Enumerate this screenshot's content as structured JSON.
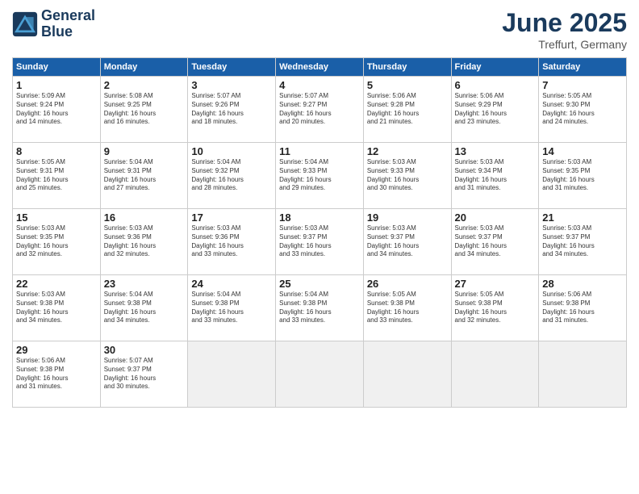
{
  "logo": {
    "line1": "General",
    "line2": "Blue"
  },
  "title": "June 2025",
  "location": "Treffurt, Germany",
  "days_header": [
    "Sunday",
    "Monday",
    "Tuesday",
    "Wednesday",
    "Thursday",
    "Friday",
    "Saturday"
  ],
  "weeks": [
    [
      {
        "day": "1",
        "lines": [
          "Sunrise: 5:09 AM",
          "Sunset: 9:24 PM",
          "Daylight: 16 hours",
          "and 14 minutes."
        ]
      },
      {
        "day": "2",
        "lines": [
          "Sunrise: 5:08 AM",
          "Sunset: 9:25 PM",
          "Daylight: 16 hours",
          "and 16 minutes."
        ]
      },
      {
        "day": "3",
        "lines": [
          "Sunrise: 5:07 AM",
          "Sunset: 9:26 PM",
          "Daylight: 16 hours",
          "and 18 minutes."
        ]
      },
      {
        "day": "4",
        "lines": [
          "Sunrise: 5:07 AM",
          "Sunset: 9:27 PM",
          "Daylight: 16 hours",
          "and 20 minutes."
        ]
      },
      {
        "day": "5",
        "lines": [
          "Sunrise: 5:06 AM",
          "Sunset: 9:28 PM",
          "Daylight: 16 hours",
          "and 21 minutes."
        ]
      },
      {
        "day": "6",
        "lines": [
          "Sunrise: 5:06 AM",
          "Sunset: 9:29 PM",
          "Daylight: 16 hours",
          "and 23 minutes."
        ]
      },
      {
        "day": "7",
        "lines": [
          "Sunrise: 5:05 AM",
          "Sunset: 9:30 PM",
          "Daylight: 16 hours",
          "and 24 minutes."
        ]
      }
    ],
    [
      {
        "day": "8",
        "lines": [
          "Sunrise: 5:05 AM",
          "Sunset: 9:31 PM",
          "Daylight: 16 hours",
          "and 25 minutes."
        ]
      },
      {
        "day": "9",
        "lines": [
          "Sunrise: 5:04 AM",
          "Sunset: 9:31 PM",
          "Daylight: 16 hours",
          "and 27 minutes."
        ]
      },
      {
        "day": "10",
        "lines": [
          "Sunrise: 5:04 AM",
          "Sunset: 9:32 PM",
          "Daylight: 16 hours",
          "and 28 minutes."
        ]
      },
      {
        "day": "11",
        "lines": [
          "Sunrise: 5:04 AM",
          "Sunset: 9:33 PM",
          "Daylight: 16 hours",
          "and 29 minutes."
        ]
      },
      {
        "day": "12",
        "lines": [
          "Sunrise: 5:03 AM",
          "Sunset: 9:33 PM",
          "Daylight: 16 hours",
          "and 30 minutes."
        ]
      },
      {
        "day": "13",
        "lines": [
          "Sunrise: 5:03 AM",
          "Sunset: 9:34 PM",
          "Daylight: 16 hours",
          "and 31 minutes."
        ]
      },
      {
        "day": "14",
        "lines": [
          "Sunrise: 5:03 AM",
          "Sunset: 9:35 PM",
          "Daylight: 16 hours",
          "and 31 minutes."
        ]
      }
    ],
    [
      {
        "day": "15",
        "lines": [
          "Sunrise: 5:03 AM",
          "Sunset: 9:35 PM",
          "Daylight: 16 hours",
          "and 32 minutes."
        ]
      },
      {
        "day": "16",
        "lines": [
          "Sunrise: 5:03 AM",
          "Sunset: 9:36 PM",
          "Daylight: 16 hours",
          "and 32 minutes."
        ]
      },
      {
        "day": "17",
        "lines": [
          "Sunrise: 5:03 AM",
          "Sunset: 9:36 PM",
          "Daylight: 16 hours",
          "and 33 minutes."
        ]
      },
      {
        "day": "18",
        "lines": [
          "Sunrise: 5:03 AM",
          "Sunset: 9:37 PM",
          "Daylight: 16 hours",
          "and 33 minutes."
        ]
      },
      {
        "day": "19",
        "lines": [
          "Sunrise: 5:03 AM",
          "Sunset: 9:37 PM",
          "Daylight: 16 hours",
          "and 34 minutes."
        ]
      },
      {
        "day": "20",
        "lines": [
          "Sunrise: 5:03 AM",
          "Sunset: 9:37 PM",
          "Daylight: 16 hours",
          "and 34 minutes."
        ]
      },
      {
        "day": "21",
        "lines": [
          "Sunrise: 5:03 AM",
          "Sunset: 9:37 PM",
          "Daylight: 16 hours",
          "and 34 minutes."
        ]
      }
    ],
    [
      {
        "day": "22",
        "lines": [
          "Sunrise: 5:03 AM",
          "Sunset: 9:38 PM",
          "Daylight: 16 hours",
          "and 34 minutes."
        ]
      },
      {
        "day": "23",
        "lines": [
          "Sunrise: 5:04 AM",
          "Sunset: 9:38 PM",
          "Daylight: 16 hours",
          "and 34 minutes."
        ]
      },
      {
        "day": "24",
        "lines": [
          "Sunrise: 5:04 AM",
          "Sunset: 9:38 PM",
          "Daylight: 16 hours",
          "and 33 minutes."
        ]
      },
      {
        "day": "25",
        "lines": [
          "Sunrise: 5:04 AM",
          "Sunset: 9:38 PM",
          "Daylight: 16 hours",
          "and 33 minutes."
        ]
      },
      {
        "day": "26",
        "lines": [
          "Sunrise: 5:05 AM",
          "Sunset: 9:38 PM",
          "Daylight: 16 hours",
          "and 33 minutes."
        ]
      },
      {
        "day": "27",
        "lines": [
          "Sunrise: 5:05 AM",
          "Sunset: 9:38 PM",
          "Daylight: 16 hours",
          "and 32 minutes."
        ]
      },
      {
        "day": "28",
        "lines": [
          "Sunrise: 5:06 AM",
          "Sunset: 9:38 PM",
          "Daylight: 16 hours",
          "and 31 minutes."
        ]
      }
    ],
    [
      {
        "day": "29",
        "lines": [
          "Sunrise: 5:06 AM",
          "Sunset: 9:38 PM",
          "Daylight: 16 hours",
          "and 31 minutes."
        ]
      },
      {
        "day": "30",
        "lines": [
          "Sunrise: 5:07 AM",
          "Sunset: 9:37 PM",
          "Daylight: 16 hours",
          "and 30 minutes."
        ]
      },
      {
        "day": "",
        "lines": []
      },
      {
        "day": "",
        "lines": []
      },
      {
        "day": "",
        "lines": []
      },
      {
        "day": "",
        "lines": []
      },
      {
        "day": "",
        "lines": []
      }
    ]
  ]
}
